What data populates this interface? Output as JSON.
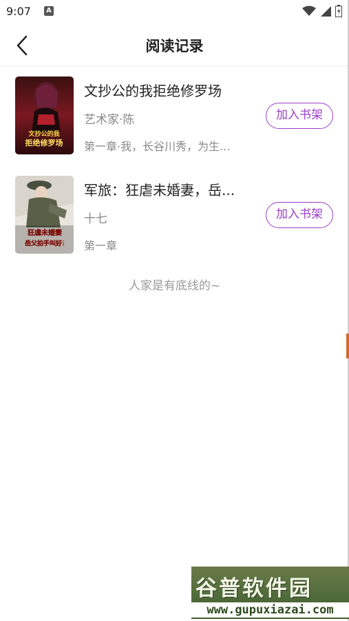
{
  "status_bar": {
    "time": "9:07",
    "app_icon_letter": "A"
  },
  "header": {
    "title": "阅读记录",
    "back_icon": "chevron-left-icon"
  },
  "books": [
    {
      "title": "文抄公的我拒绝修罗场",
      "author": "艺术家·陈",
      "chapter": "第一章·我，长谷川秀，为生...",
      "button": "加入书架",
      "cover_text_top": "文抄公的我",
      "cover_text_bottom": "拒绝修罗场"
    },
    {
      "title": "军旅：狂虐未婚妻，岳...",
      "author": "十七",
      "chapter": "第一章",
      "button": "加入书架",
      "cover_text_top": "狂虐未婚妻",
      "cover_text_bottom": "岳父拍手叫好!"
    }
  ],
  "footer_text": "人家是有底线的~",
  "watermark": {
    "title": "谷普软件园",
    "url": "www.gupuxiazai.com"
  },
  "colors": {
    "accent": "#9b3fc7",
    "secondary_text": "#888888"
  }
}
